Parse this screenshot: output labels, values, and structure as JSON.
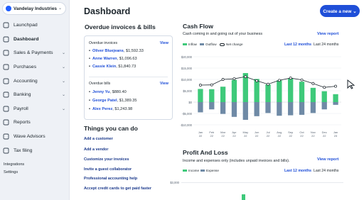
{
  "sidebar": {
    "company_name": "Vandelay Industries",
    "items": [
      {
        "label": "Launchpad",
        "icon": "rocket-icon",
        "name": "launchpad",
        "caret": ""
      },
      {
        "label": "Dashboard",
        "icon": "dashboard-icon",
        "name": "dashboard",
        "caret": ""
      },
      {
        "label": "Sales & Payments",
        "icon": "sales-icon",
        "name": "sales-payments",
        "caret": "⌄"
      },
      {
        "label": "Purchases",
        "icon": "purchases-icon",
        "name": "purchases",
        "caret": "⌄"
      },
      {
        "label": "Accounting",
        "icon": "accounting-icon",
        "name": "accounting",
        "caret": "⌄"
      },
      {
        "label": "Banking",
        "icon": "bank-icon",
        "name": "banking",
        "caret": "⌄"
      },
      {
        "label": "Payroll",
        "icon": "payroll-icon",
        "name": "payroll",
        "caret": "⌄"
      },
      {
        "label": "Reports",
        "icon": "reports-icon",
        "name": "reports",
        "caret": ""
      },
      {
        "label": "Wave Advisors",
        "icon": "advisors-icon",
        "name": "wave-advisors",
        "caret": ""
      },
      {
        "label": "Tax filing",
        "icon": "tax-icon",
        "name": "tax-filing",
        "caret": ""
      }
    ],
    "footer": [
      "Integrations",
      "Settings"
    ]
  },
  "header": {
    "title": "Dashboard",
    "create_button": "Create a new ⌄"
  },
  "overdue": {
    "title": "Overdue invoices & bills",
    "invoices_heading": "Overdue invoices",
    "bills_heading": "Overdue bills",
    "view_label": "View",
    "invoices": [
      {
        "name": "Oliver Bluejeans",
        "amount": ", $1,592.33"
      },
      {
        "name": "Anne Warren",
        "amount": ", $1,096.63"
      },
      {
        "name": "Cassie Klein",
        "amount": ", $1,840.73"
      }
    ],
    "bills": [
      {
        "name": "Jenny Yu",
        "amount": ", $880.40"
      },
      {
        "name": "George Patel",
        "amount": ", $1,389.35"
      },
      {
        "name": "Alex Perez",
        "amount": ", $1,243.98"
      }
    ]
  },
  "todo": {
    "title": "Things you can do",
    "links": [
      "Add a customer",
      "Add a vendor",
      "Customize your invoices",
      "Invite a guest collaborator",
      "Professional accounting help",
      "Accept credit cards to get paid faster"
    ]
  },
  "cashflow": {
    "title": "Cash Flow",
    "subtitle": "Cash coming in and going out of your business",
    "view_report": "View report",
    "period_selected": "Last 12 months",
    "period_other": "Last 24 months",
    "legend": [
      "Inflow",
      "Outflow",
      "Net change"
    ]
  },
  "pnl": {
    "title": "Profit And Loss",
    "subtitle": "Income and expenses only (includes unpaid invoices and bills).",
    "view_report": "View report",
    "period_selected": "Last 12 months",
    "period_other": "Last 24 months",
    "legend": [
      "Income",
      "Expense"
    ],
    "ytick": "$3,000"
  },
  "colors": {
    "inflow": "#3ec97a",
    "outflow": "#6f8aa6",
    "net": "#1c252c",
    "accent": "#1f4fd8"
  },
  "chart_data": [
    {
      "type": "bar",
      "title": "Cash Flow",
      "categories": [
        "Jan 2022",
        "Feb 2022",
        "Mar 2022",
        "Apr 2022",
        "May 2022",
        "Jun 2022",
        "Jul 2022",
        "Aug 2022",
        "Sep 2022",
        "Oct 2022",
        "Nov 2022",
        "Dec 2022",
        "Jan 2023"
      ],
      "x_tick_labels": [
        [
          "Jan",
          "22"
        ],
        [
          "Feb",
          "22"
        ],
        [
          "Mar",
          "22"
        ],
        [
          "Apr",
          "22"
        ],
        [
          "May",
          "22"
        ],
        [
          "Jun",
          "22"
        ],
        [
          "Jul",
          "22"
        ],
        [
          "Aug",
          "22"
        ],
        [
          "Sep",
          "22"
        ],
        [
          "Oct",
          "22"
        ],
        [
          "Nov",
          "22"
        ],
        [
          "Dec",
          "22"
        ],
        [
          "Jan",
          "23"
        ]
      ],
      "y_tick_labels": [
        "$20,000",
        "$15,000",
        "$10,000",
        "$5,000",
        "$0",
        "-$5,000",
        "-$10,000"
      ],
      "ylim": [
        -10000,
        20000
      ],
      "series": [
        {
          "name": "Inflow",
          "values": [
            5800,
            5700,
            6800,
            9800,
            12800,
            10200,
            7800,
            9600,
            10500,
            9000,
            6300,
            4800,
            3500
          ]
        },
        {
          "name": "Outflow",
          "values": [
            -4500,
            -3200,
            -5200,
            -6500,
            -7800,
            -6200,
            -4800,
            -6000,
            -5800,
            -5600,
            -4800,
            -3200,
            -1200
          ]
        },
        {
          "name": "Net change",
          "values": [
            7500,
            7600,
            10000,
            10300,
            11200,
            9400,
            7900,
            9600,
            10600,
            9800,
            8200,
            6500,
            7000
          ]
        }
      ],
      "legend": "top-left",
      "grid": true
    }
  ]
}
